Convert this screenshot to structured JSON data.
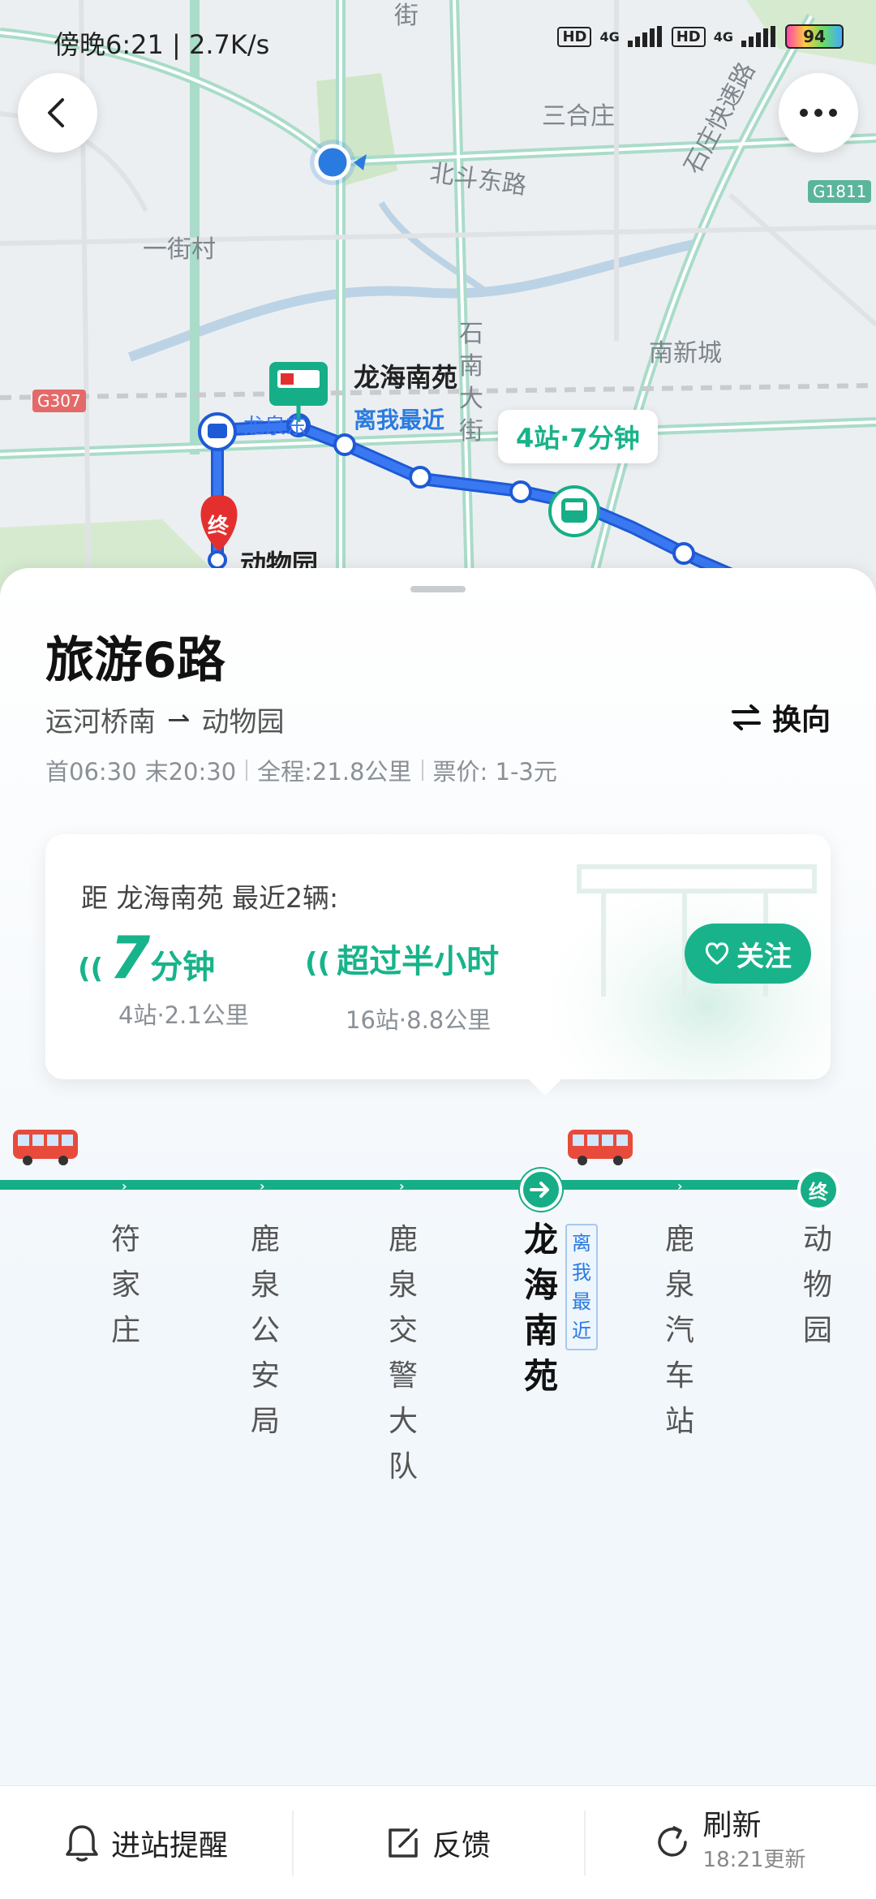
{
  "status_bar": {
    "time": "傍晚6:21 | 2.7K/s",
    "hd1": "HD",
    "net1": "4G",
    "hd2": "HD",
    "net2": "4G",
    "battery": "94"
  },
  "map": {
    "labels": {
      "jie": "街",
      "sanhezhuang": "三合庄",
      "beidou": "北斗东路",
      "yijiecun": "一街村",
      "nanxincheng": "南新城",
      "shinan": "石南大街",
      "longdong": "龙泉东",
      "highway": "石庄快速路",
      "g307": "G307",
      "g1811": "G1811"
    },
    "stop_name": "龙海南苑",
    "nearest_label": "离我最近",
    "eta_bubble": "4站·7分钟",
    "terminal_badge": "终",
    "terminal_name": "动物园"
  },
  "line": {
    "title": "旅游6路",
    "from": "运河桥南",
    "to": "动物园",
    "reverse_label": "换向",
    "first_bus": "首06:30",
    "last_bus": "末20:30",
    "distance": "全程:21.8公里",
    "fare": "票价: 1-3元"
  },
  "arrival": {
    "heading": "距 龙海南苑 最近2辆:",
    "bus1": {
      "num": "7",
      "unit": "分钟",
      "detail": "4站·2.1公里"
    },
    "bus2": {
      "text": "超过半小时",
      "detail": "16站·8.8公里"
    },
    "follow_label": "关注"
  },
  "stations": [
    {
      "name": "符家庄"
    },
    {
      "name": "鹿泉公安局"
    },
    {
      "name": "鹿泉交警大队"
    },
    {
      "name": "龙海南苑"
    },
    {
      "name": "鹿泉汽车站"
    },
    {
      "name": "动物园"
    }
  ],
  "nearest_tag": "离我最近",
  "terminal_node": "终",
  "bottom": {
    "remind": "进站提醒",
    "feedback": "反馈",
    "refresh": "刷新",
    "updated": "18:21更新"
  },
  "colors": {
    "accent": "#16ae86",
    "blue": "#2a7be0"
  }
}
